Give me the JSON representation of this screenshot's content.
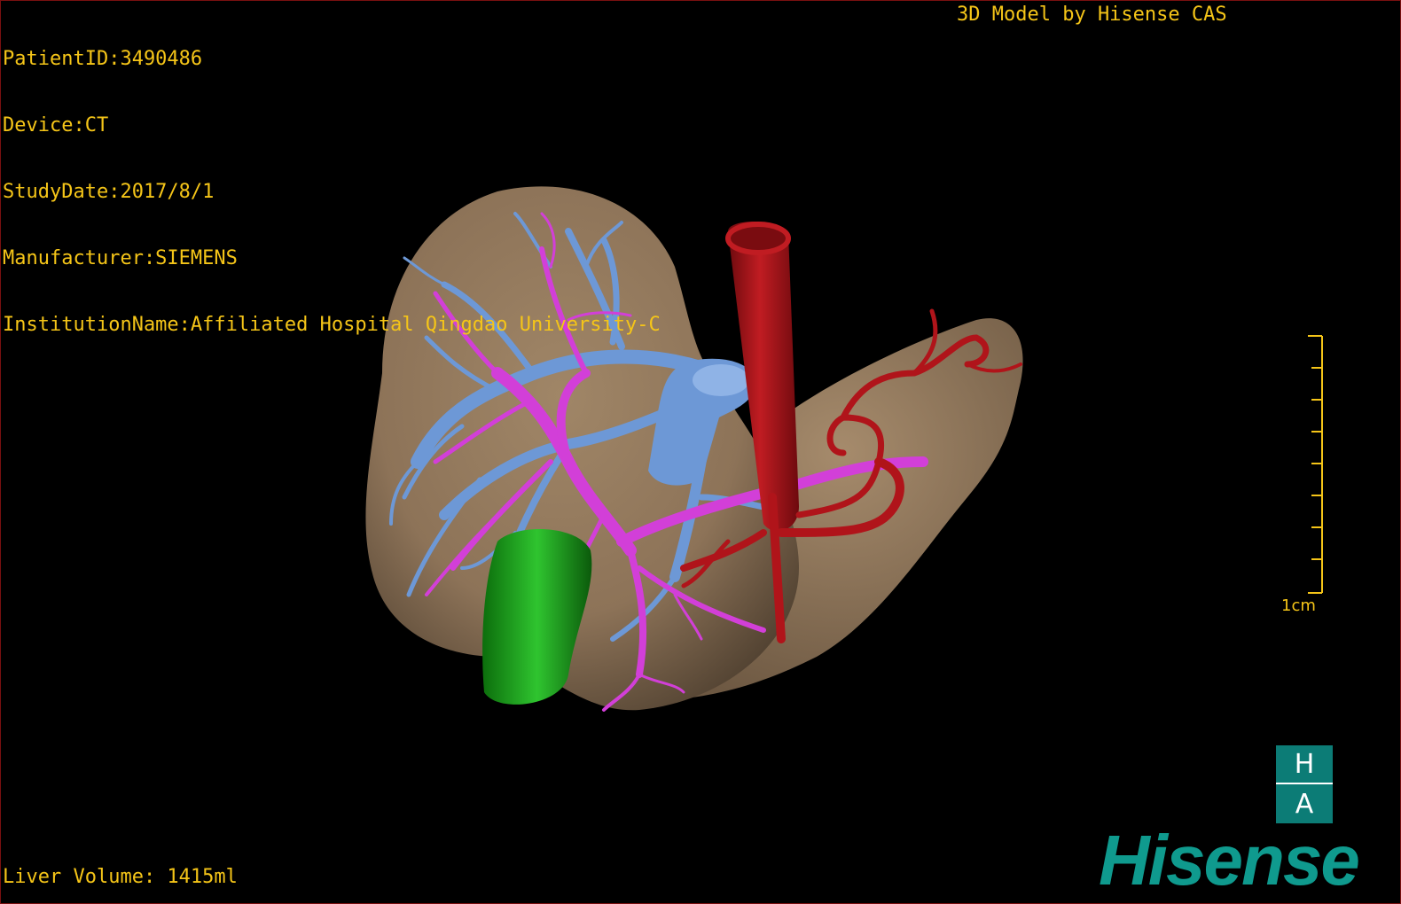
{
  "overlay": {
    "patient_id": "PatientID:3490486",
    "device": "Device:CT",
    "study_date": "StudyDate:2017/8/1",
    "manufacturer": "Manufacturer:SIEMENS",
    "institution": "InstitutionName:Affiliated Hospital Qingdao University-C",
    "credit": "3D Model by Hisense CAS",
    "liver_volume": "Liver Volume: 1415ml"
  },
  "scale": {
    "label": "1cm"
  },
  "logo": {
    "top": "H",
    "bottom": "A",
    "brand": "Hisense"
  },
  "colors": {
    "overlay_text": "#f5c518",
    "liver": "#8d7358",
    "portal_vein": "#d23fd8",
    "hepatic_vein": "#6d98d6",
    "artery": "#b0141a",
    "gallbladder": "#1faa1f",
    "brand": "#0f9a8e"
  }
}
